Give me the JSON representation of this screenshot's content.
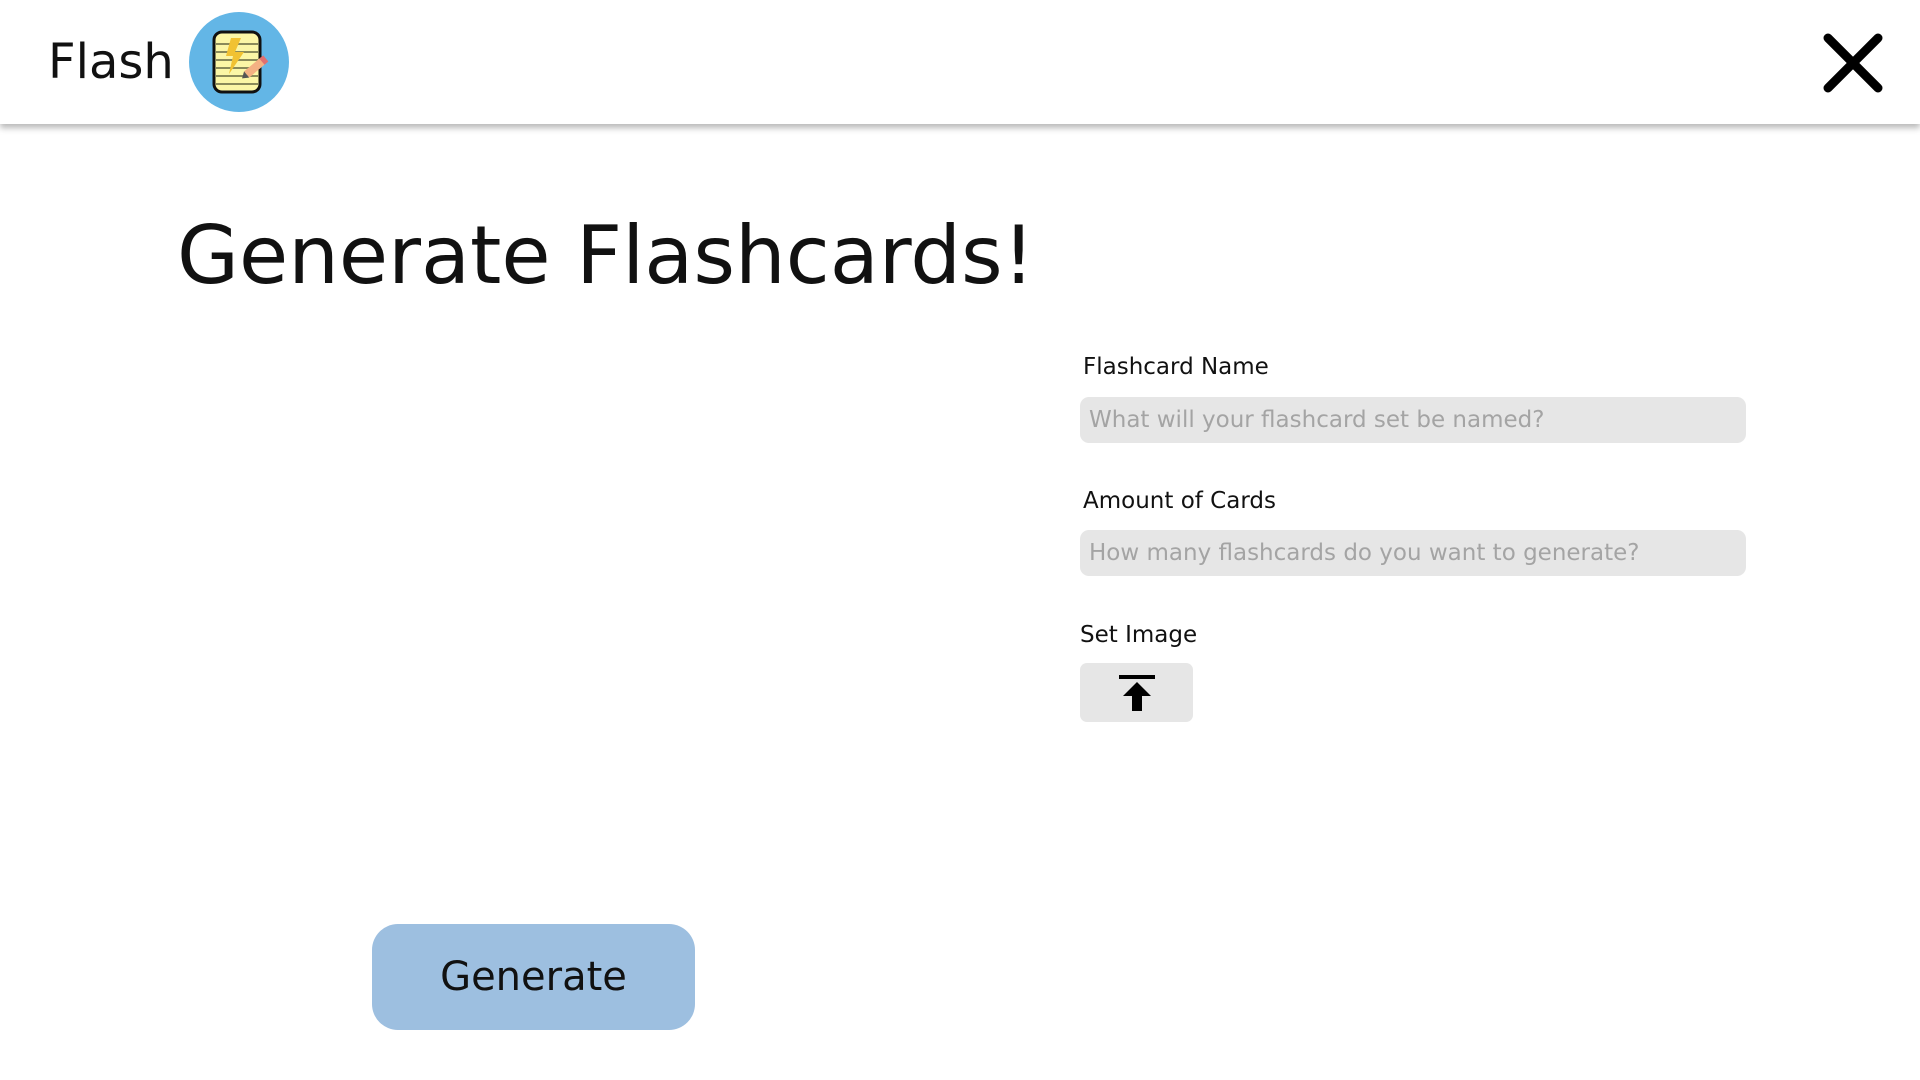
{
  "app": {
    "name": "Flash",
    "logo_icon": "notepad-lightning-icon",
    "close_icon": "close-icon"
  },
  "page": {
    "title": "Generate Flashcards!"
  },
  "form": {
    "name_label": "Flashcard Name",
    "name_placeholder": "What will your flashcard set be named?",
    "name_value": "",
    "amount_label": "Amount of Cards",
    "amount_placeholder": "How many flashcards do you want to generate?",
    "amount_value": "",
    "image_label": "Set Image",
    "upload_icon": "upload-icon"
  },
  "actions": {
    "generate_label": "Generate"
  },
  "colors": {
    "logo_circle": "#63b6e6",
    "generate_button": "#9dbfe0",
    "input_background": "#e6e6e6",
    "placeholder_text": "#a4a4a4"
  }
}
